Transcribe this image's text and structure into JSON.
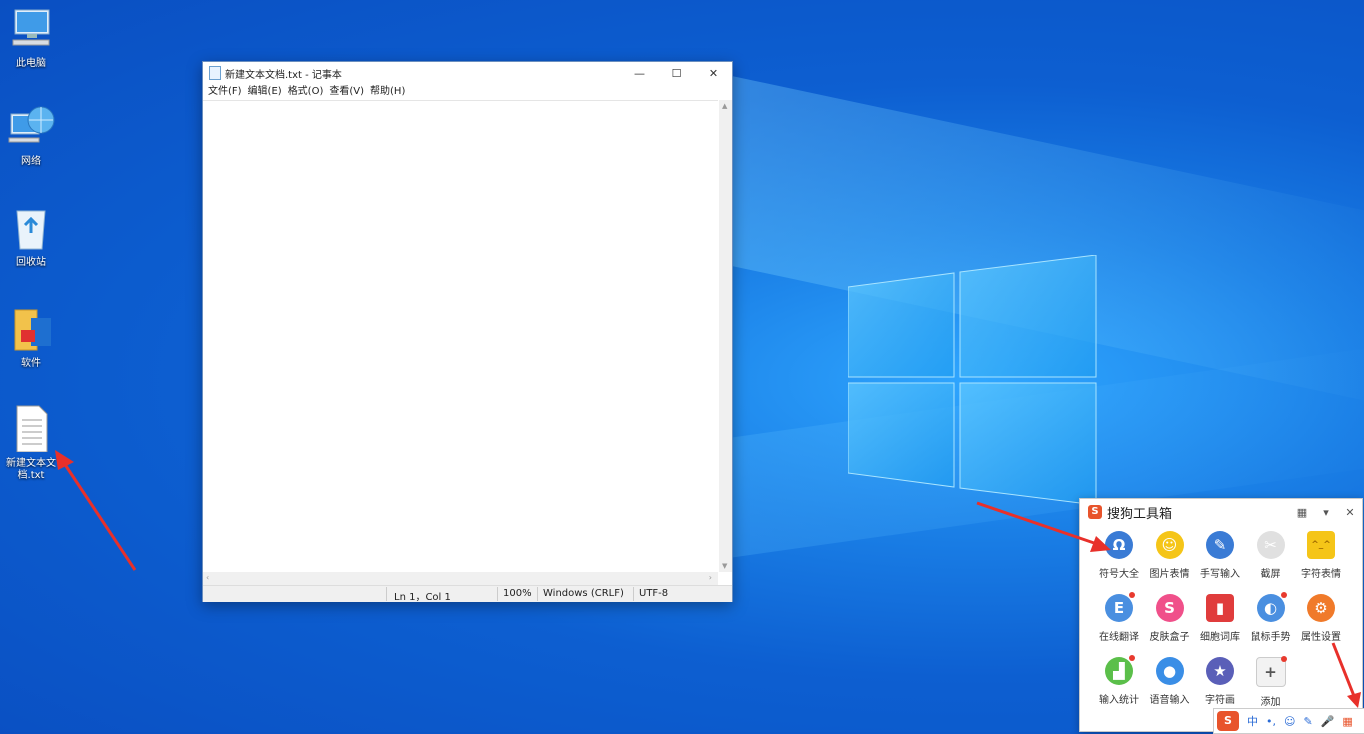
{
  "desktop": {
    "icons": [
      {
        "label": "此电脑",
        "icon": "computer-icon"
      },
      {
        "label": "网络",
        "icon": "network-icon"
      },
      {
        "label": "回收站",
        "icon": "recycle-bin-icon"
      },
      {
        "label": "软件",
        "icon": "folder-icon"
      },
      {
        "label": "新建文本文档.txt",
        "icon": "text-file-icon"
      }
    ]
  },
  "notepad": {
    "title": "新建文本文档.txt - 记事本",
    "window_buttons": {
      "minimize": "—",
      "maximize": "☐",
      "close": "✕"
    },
    "menu": [
      "文件(F)",
      "编辑(E)",
      "格式(O)",
      "查看(V)",
      "帮助(H)"
    ],
    "content": "",
    "status": {
      "position": "Ln 1，Col 1",
      "zoom": "100%",
      "line_ending": "Windows (CRLF)",
      "encoding": "UTF-8"
    }
  },
  "toolbox": {
    "title": "搜狗工具箱",
    "logo_letter": "S",
    "header_buttons": {
      "skin": "▦",
      "menu": "▾",
      "close": "✕"
    },
    "items": [
      {
        "label": "符号大全",
        "icon": "omega-icon",
        "color": "#3a7bd5",
        "glyph": "Ω",
        "dot": false
      },
      {
        "label": "图片表情",
        "icon": "emoji-icon",
        "color": "#f5c518",
        "glyph": "☺",
        "dot": false
      },
      {
        "label": "手写输入",
        "icon": "pen-icon",
        "color": "#3a7bd5",
        "glyph": "✎",
        "dot": false
      },
      {
        "label": "截屏",
        "icon": "scissors-icon",
        "color": "#e0e0e0",
        "glyph": "✂",
        "dot": false
      },
      {
        "label": "字符表情",
        "icon": "char-emoji-icon",
        "color": "#f5c518",
        "glyph": "^_^",
        "dot": false
      },
      {
        "label": "在线翻译",
        "icon": "translate-icon",
        "color": "#4a8fe0",
        "glyph": "E",
        "dot": true
      },
      {
        "label": "皮肤盒子",
        "icon": "skin-icon",
        "color": "#f0508a",
        "glyph": "S",
        "dot": false
      },
      {
        "label": "细胞词库",
        "icon": "book-icon",
        "color": "#e03c3c",
        "glyph": "▮",
        "dot": false
      },
      {
        "label": "鼠标手势",
        "icon": "mouse-icon",
        "color": "#4a8fe0",
        "glyph": "◐",
        "dot": true
      },
      {
        "label": "属性设置",
        "icon": "gear-icon",
        "color": "#f07a2a",
        "glyph": "⚙",
        "dot": false
      },
      {
        "label": "输入统计",
        "icon": "stats-icon",
        "color": "#5bbf4a",
        "glyph": "▟",
        "dot": true
      },
      {
        "label": "语音输入",
        "icon": "microphone-icon",
        "color": "#3a8ee6",
        "glyph": "●",
        "dot": false
      },
      {
        "label": "字符画",
        "icon": "char-art-icon",
        "color": "#5a5fb8",
        "glyph": "★",
        "dot": false
      },
      {
        "label": "添加",
        "icon": "plus-icon",
        "color": "#f2f2f2",
        "glyph": "+",
        "dot": true
      }
    ]
  },
  "imebar": {
    "logo": "S",
    "items": [
      {
        "label": "中",
        "icon": "chinese-mode-icon"
      },
      {
        "label": "•,",
        "icon": "punctuation-icon"
      },
      {
        "label": "☺",
        "icon": "emoji-icon"
      },
      {
        "label": "✎",
        "icon": "handwriting-icon"
      },
      {
        "label": "🎤",
        "icon": "microphone-icon"
      },
      {
        "label": "▦",
        "icon": "toolbox-icon"
      }
    ]
  }
}
